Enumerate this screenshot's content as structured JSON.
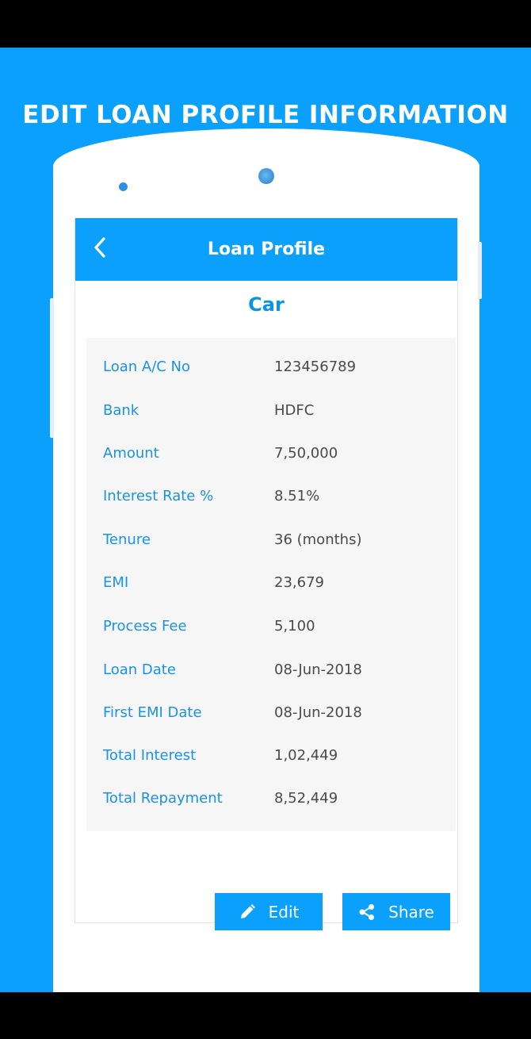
{
  "promo": {
    "title": "EDIT LOAN PROFILE INFORMATION"
  },
  "header": {
    "title": "Loan Profile",
    "back_icon": "chevron-left-icon"
  },
  "loan": {
    "type": "Car",
    "details": [
      {
        "label": "Loan A/C No",
        "value": "123456789"
      },
      {
        "label": "Bank",
        "value": "HDFC"
      },
      {
        "label": "Amount",
        "value": "7,50,000"
      },
      {
        "label": "Interest Rate %",
        "value": "8.51%"
      },
      {
        "label": "Tenure",
        "value": "36 (months)"
      },
      {
        "label": "EMI",
        "value": "23,679"
      },
      {
        "label": "Process Fee",
        "value": "5,100"
      },
      {
        "label": "Loan Date",
        "value": "08-Jun-2018"
      },
      {
        "label": "First EMI Date",
        "value": "08-Jun-2018"
      },
      {
        "label": "Total Interest",
        "value": "1,02,449"
      },
      {
        "label": "Total Repayment",
        "value": "8,52,449"
      }
    ]
  },
  "actions": {
    "edit_label": "Edit",
    "edit_icon": "pencil-icon",
    "share_label": "Share",
    "share_icon": "share-icon"
  },
  "colors": {
    "brand_blue": "#0aa0fb",
    "label_blue": "#1a92e6",
    "value_gray": "#4a4a4a"
  }
}
